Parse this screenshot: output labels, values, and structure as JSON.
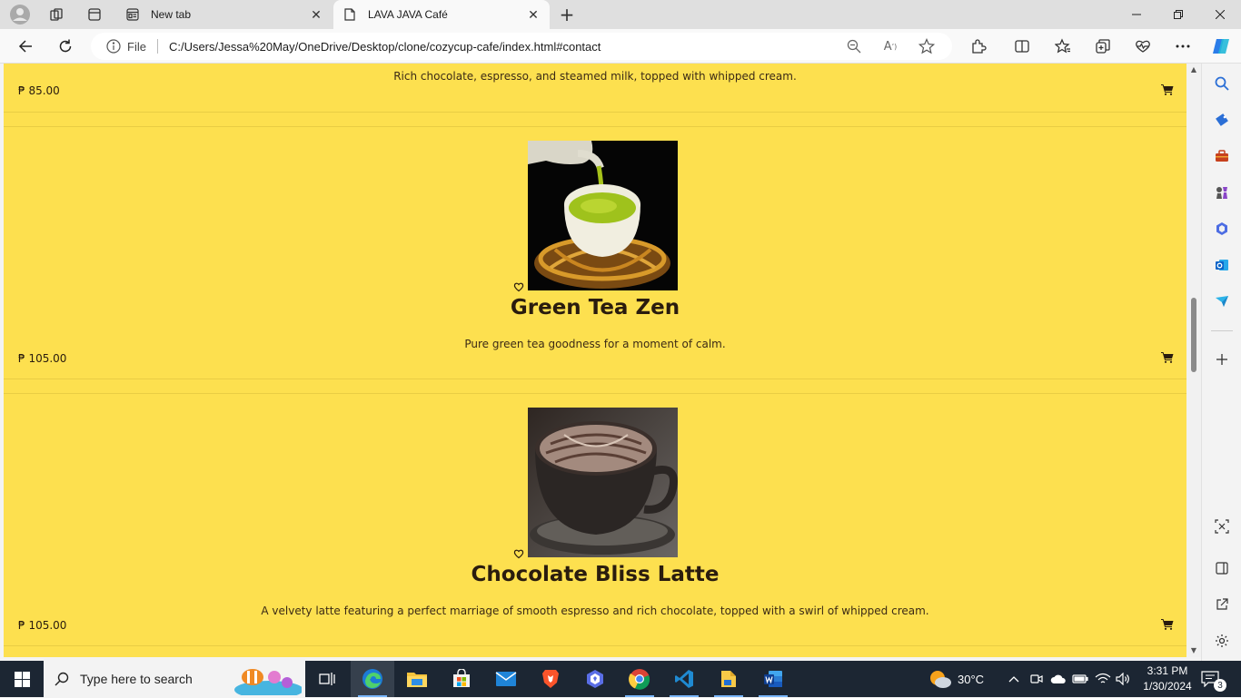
{
  "browser": {
    "tabs": [
      {
        "title": "New tab"
      },
      {
        "title": "LAVA JAVA Café"
      }
    ],
    "address": {
      "scheme_label": "File",
      "url": "C:/Users/Jessa%20May/OneDrive/Desktop/clone/cozycup-cafe/index.html#contact"
    }
  },
  "menu": {
    "items": [
      {
        "description": "Rich chocolate, espresso, and steamed milk, topped with whipped cream.",
        "price": "₱ 85.00"
      },
      {
        "name": "Green Tea Zen",
        "description": "Pure green tea goodness for a moment of calm.",
        "price": "₱ 105.00"
      },
      {
        "name": "Chocolate Bliss Latte",
        "description": "A velvety latte featuring a perfect marriage of smooth espresso and rich chocolate, topped with a swirl of whipped cream.",
        "price": "₱ 105.00"
      }
    ]
  },
  "taskbar": {
    "search_placeholder": "Type here to search",
    "weather": "30°C",
    "time": "3:31 PM",
    "date": "1/30/2024",
    "notification_count": "3"
  },
  "colors": {
    "page_bg": "#fde04f",
    "text_dark": "#2a1c0e",
    "taskbar": "#1c2633"
  }
}
